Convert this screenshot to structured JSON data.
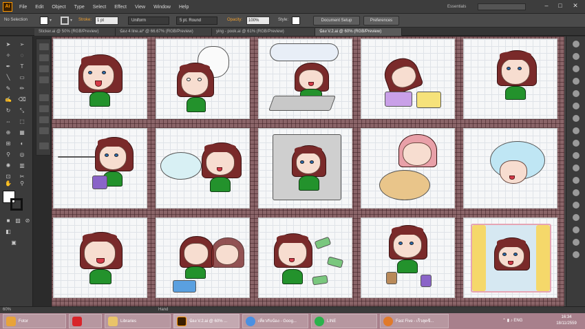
{
  "app": {
    "logo": "Ai"
  },
  "menubar": {
    "items": [
      "File",
      "Edit",
      "Object",
      "Type",
      "Select",
      "Effect",
      "View",
      "Window",
      "Help"
    ],
    "workspace": "Essentials",
    "window_controls": [
      "–",
      "□",
      "✕"
    ]
  },
  "control": {
    "selection": "No Selection",
    "stroke_label": "Stroke:",
    "stroke_weight": "1 pt",
    "uniform": "Uniform",
    "brush": "5 pt. Round",
    "opacity_label": "Opacity:",
    "opacity_value": "100%",
    "style_label": "Style:",
    "document_setup": "Document Setup",
    "preferences": "Preferences"
  },
  "tabs": [
    {
      "label": "Sticker.ai @ 50% (RGB/Preview)",
      "active": false
    },
    {
      "label": "น้อง 4 line.ai* @ 66.67% (RGB/Preview)",
      "active": false
    },
    {
      "label": "ying - pook.ai @ 61% (RGB/Preview)",
      "active": false
    },
    {
      "label": "น้อง V.2.ai @ 60% (RGB/Preview)",
      "active": true
    }
  ],
  "status": {
    "zoom": "60%",
    "tool": "Hand"
  },
  "taskbar": {
    "items": [
      {
        "label": "Fotor",
        "icon_color": "#e8a33a",
        "icon": "fotor-icon"
      },
      {
        "label": "",
        "icon_color": "#d8242a",
        "icon": "app-icon"
      },
      {
        "label": "Libraries",
        "icon_color": "#e9c46a",
        "icon": "folder-icon"
      },
      {
        "label": "น้อง V.2.ai @ 60% ...",
        "icon_color": "#3a1f00",
        "icon": "illustrator-icon"
      },
      {
        "label": "เที่ยวกับน้อง - Goog...",
        "icon_color": "#4a90e2",
        "icon": "chrome-icon"
      },
      {
        "label": "LINE",
        "icon_color": "#2bb24c",
        "icon": "line-icon"
      },
      {
        "label": "Fast Five - เร็วสุดขี...",
        "icon_color": "#e07a2a",
        "icon": "media-icon"
      }
    ],
    "tray_lang": "ENG",
    "time": "16:34",
    "date": "18/11/2559"
  },
  "colors": {
    "hair": "#7a2a2a",
    "shirt": "#23922c",
    "skin": "#f7ddd0",
    "canvas_bg": "#8a6468",
    "taskbar": "#a8808c"
  }
}
